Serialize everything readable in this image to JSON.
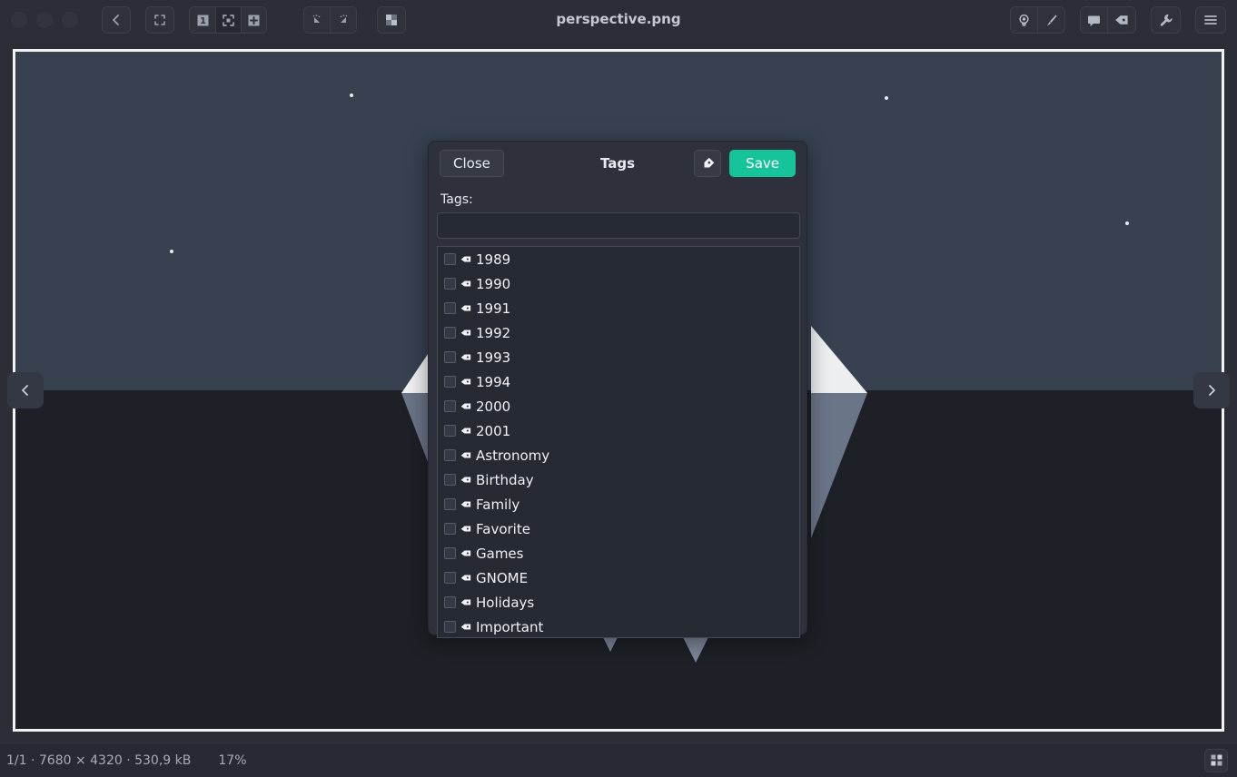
{
  "window": {
    "title": "perspective.png",
    "traffic_lights": [
      "close",
      "minimize",
      "maximize"
    ]
  },
  "toolbar": {
    "back_label": "back-arrow",
    "crop_label": "crop-icon",
    "zoom_group": [
      {
        "name": "zoom-100",
        "label": "1"
      },
      {
        "name": "zoom-fit",
        "label": "fit"
      },
      {
        "name": "zoom-in",
        "label": "+"
      }
    ],
    "rotate_group": [
      {
        "name": "rotate-left",
        "label": "rotate-left-icon"
      },
      {
        "name": "rotate-right",
        "label": "rotate-right-icon"
      }
    ],
    "transparency_label": "checkerboard-icon",
    "right_group": [
      {
        "name": "lightbulb",
        "label": "lightbulb-icon"
      },
      {
        "name": "brush",
        "label": "brush-icon"
      },
      {
        "name": "comment",
        "label": "comment-icon"
      },
      {
        "name": "tag",
        "label": "tag-icon"
      },
      {
        "name": "wrench",
        "label": "wrench-icon"
      },
      {
        "name": "menu",
        "label": "hamburger-icon"
      }
    ]
  },
  "navigation": {
    "prev_label": "‹",
    "next_label": "›"
  },
  "dialog": {
    "title": "Tags",
    "close_label": "Close",
    "save_label": "Save",
    "tag_icon_button": "tag-icon",
    "field_label": "Tags:",
    "input_value": "",
    "input_placeholder": "",
    "tags": [
      {
        "label": "1989",
        "checked": false
      },
      {
        "label": "1990",
        "checked": false
      },
      {
        "label": "1991",
        "checked": false
      },
      {
        "label": "1992",
        "checked": false
      },
      {
        "label": "1993",
        "checked": false
      },
      {
        "label": "1994",
        "checked": false
      },
      {
        "label": "2000",
        "checked": false
      },
      {
        "label": "2001",
        "checked": false
      },
      {
        "label": "Astronomy",
        "checked": false
      },
      {
        "label": "Birthday",
        "checked": false
      },
      {
        "label": "Family",
        "checked": false
      },
      {
        "label": "Favorite",
        "checked": false
      },
      {
        "label": "Games",
        "checked": false
      },
      {
        "label": "GNOME",
        "checked": false
      },
      {
        "label": "Holidays",
        "checked": false
      },
      {
        "label": "Important",
        "checked": false
      }
    ]
  },
  "statusbar": {
    "info": "1/1  ·  7680 × 4320  ·  530,9 kB",
    "zoom": "17%",
    "grid_label": "grid-view-icon"
  },
  "colors": {
    "accent_save": "#17c39a",
    "window_bg": "#2b2e36",
    "dialog_bg": "#2e313b",
    "list_bg": "#262a33",
    "image_sky": "#374150",
    "image_ground": "#1d2026",
    "image_highlight": "#f2f2f2",
    "image_shadow": "#6b7588"
  }
}
